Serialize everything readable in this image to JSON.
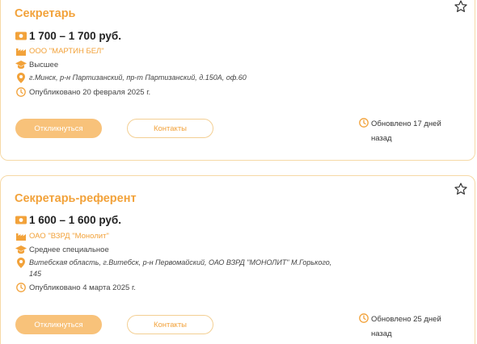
{
  "vacancies": [
    {
      "title": "Секретарь",
      "salary": "1 700 – 1 700 руб.",
      "company": "ООО \"МАРТИН БЕЛ\"",
      "education": "Высшее",
      "address_line1": "г.Минск, р-н Партизанский, пр-т Партизанский, д.150А, оф.60",
      "address_line2": "",
      "published": "Опубликовано 20 февраля 2025 г.",
      "apply_label": "Откликнуться",
      "contacts_label": "Контакты",
      "updated_line1": "Обновлено 17 дней",
      "updated_line2": "назад"
    },
    {
      "title": "Секретарь-референт",
      "salary": "1 600 – 1 600 руб.",
      "company": "ОАО \"ВЗРД \"Монолит\"",
      "education": "Среднее специальное",
      "address_line1": "Витебская область, г.Витебск, р-н Первомайский, ОАО ВЗРД \"МОНОЛИТ\" М.Горького,",
      "address_line2": "145",
      "published": "Опубликовано 4 марта 2025 г.",
      "apply_label": "Откликнуться",
      "contacts_label": "Контакты",
      "updated_line1": "Обновлено 25 дней",
      "updated_line2": "назад"
    }
  ],
  "icons": {
    "favorite": "star-outline-icon",
    "salary": "money-icon",
    "company": "factory-icon",
    "education": "graduation-cap-icon",
    "address": "location-pin-icon",
    "published": "clock-icon",
    "updated": "clock-icon"
  },
  "colors": {
    "accent": "#f2a23a",
    "button_fill": "#f8c27a",
    "card_border": "#f6d9a6"
  }
}
